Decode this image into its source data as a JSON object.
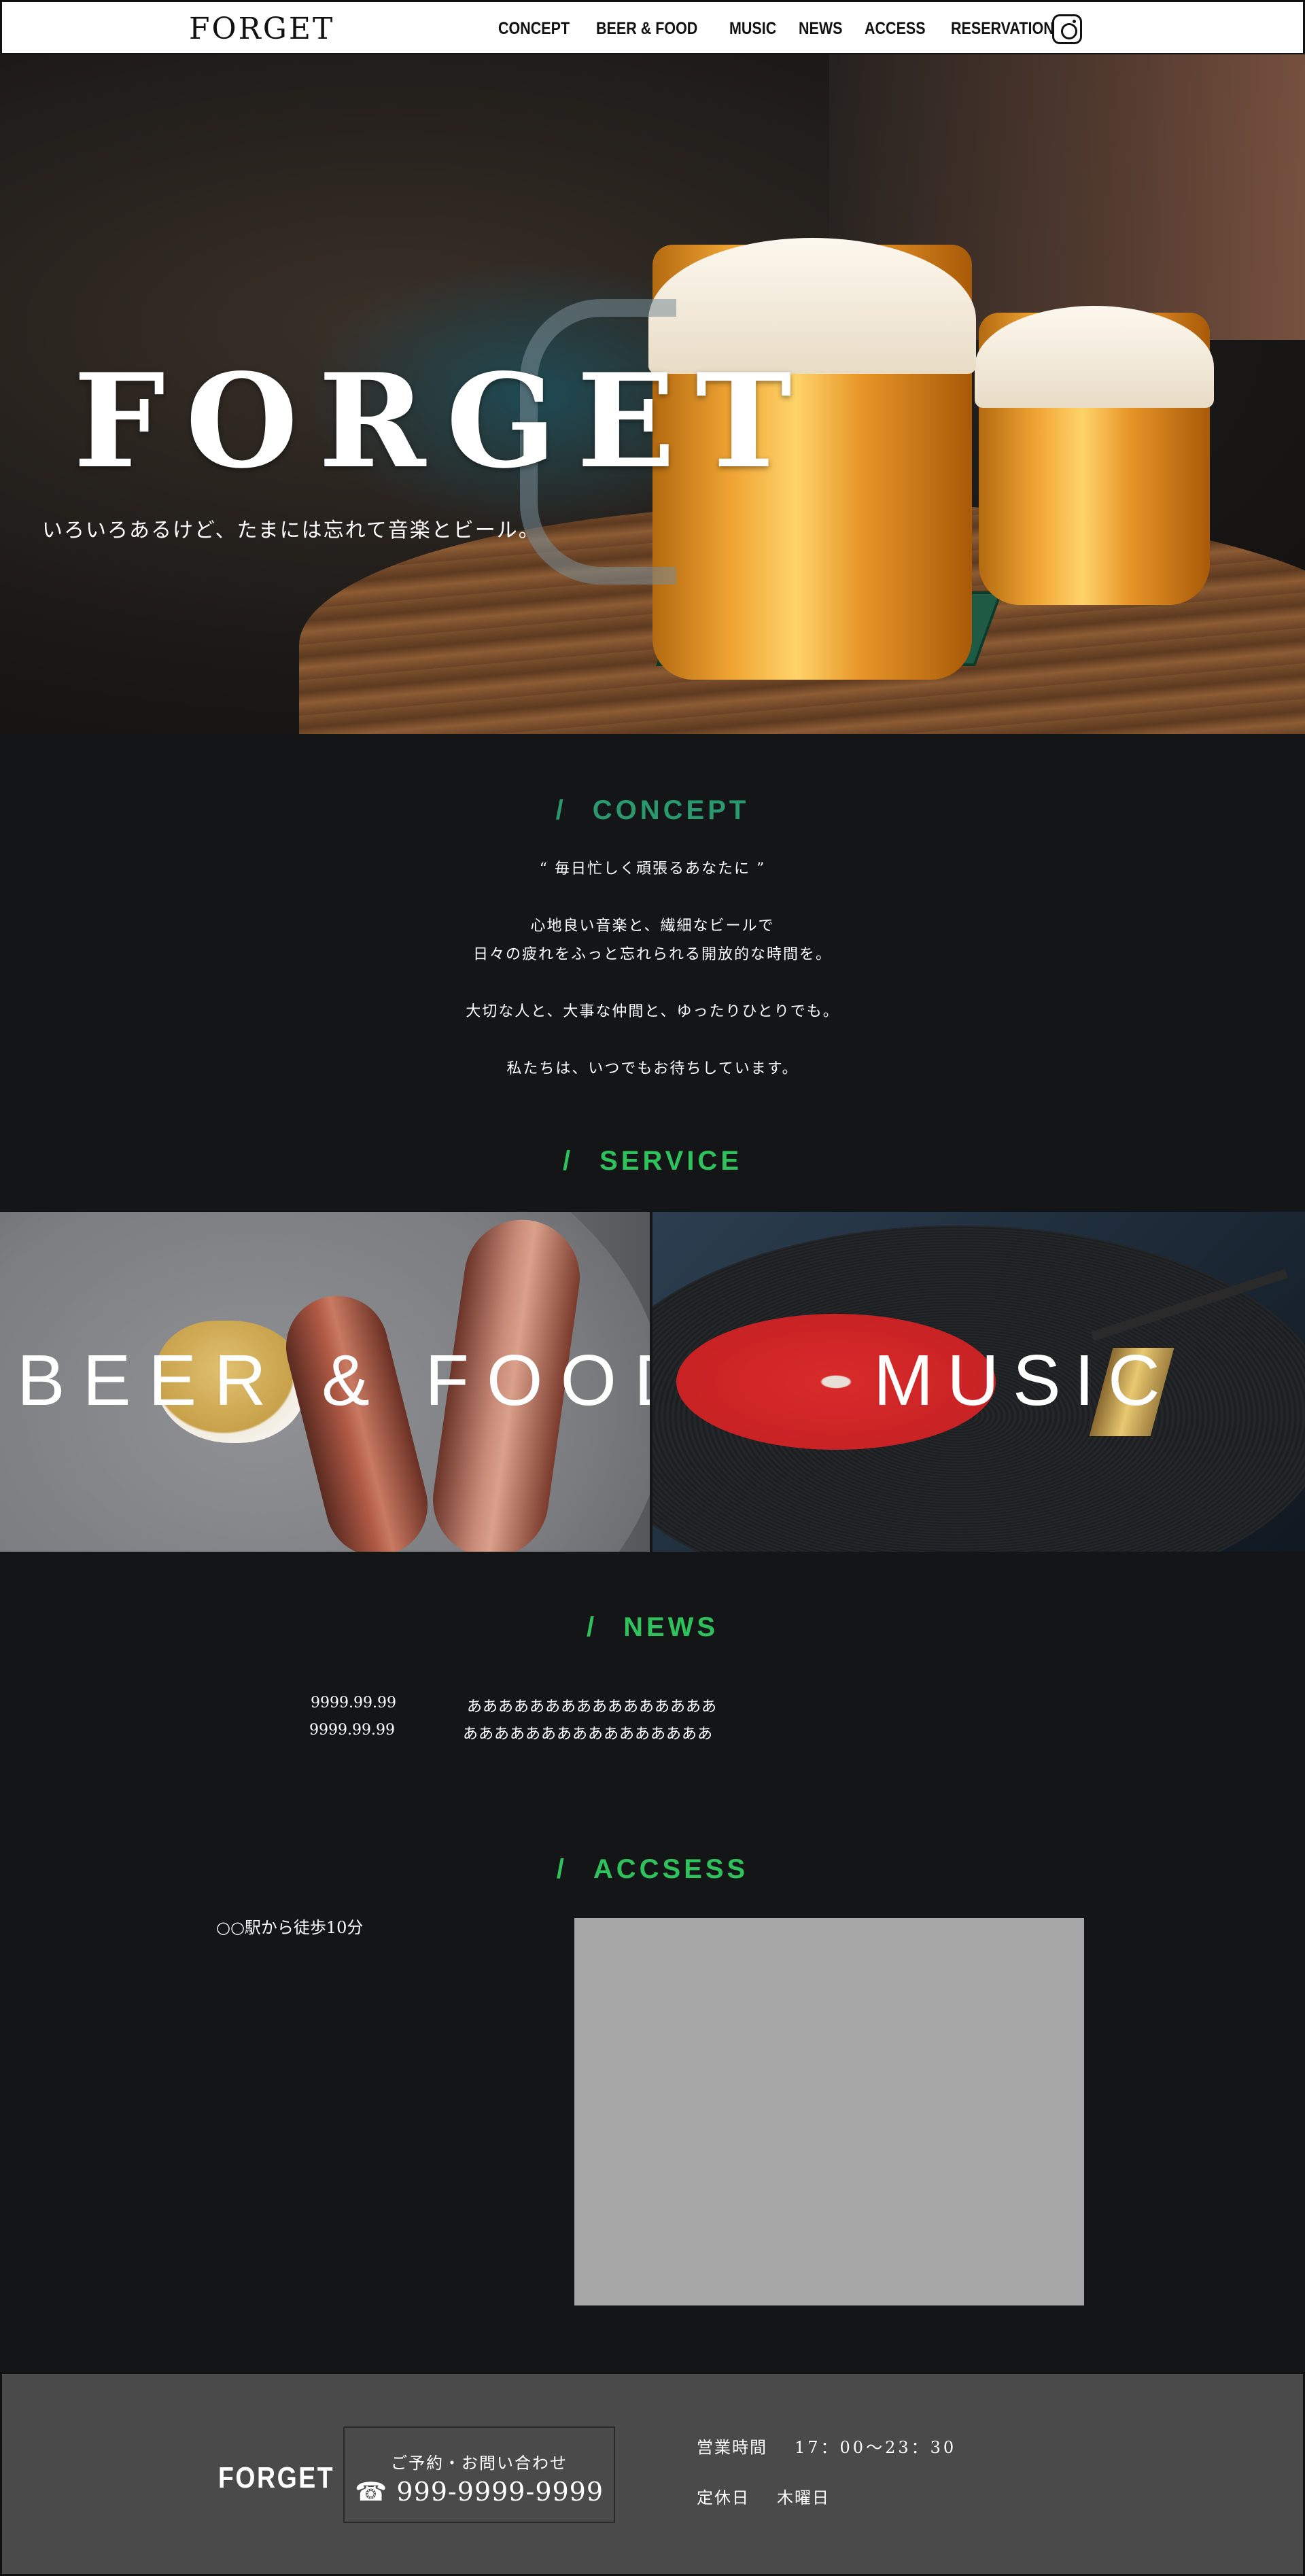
{
  "header": {
    "logo": "FORGET",
    "nav": [
      "CONCEPT",
      "BEER & FOOD",
      "MUSIC",
      "NEWS",
      "ACCESS",
      "RESERVATION"
    ],
    "instagram_icon": "instagram-icon"
  },
  "hero": {
    "title": "FORGET",
    "subtitle": "いろいろあるけど、たまには忘れて音楽とビール。"
  },
  "concept": {
    "heading": "CONCEPT",
    "lines": [
      "“ 毎日忙しく頑張るあなたに ”",
      "心地良い音楽と、繊細なビールで",
      "日々の疲れをふっと忘れられる開放的な時間を。",
      "大切な人と、大事な仲間と、ゆったりひとりでも。",
      "私たちは、いつでもお待ちしています。"
    ]
  },
  "service": {
    "heading": "SERVICE",
    "items": [
      {
        "label": "BEER & FOOD"
      },
      {
        "label": "MUSIC"
      }
    ]
  },
  "news": {
    "heading": "NEWS",
    "items": [
      {
        "date": "9999.99.99",
        "title": "ああああああああああああああああ"
      },
      {
        "date": "9999.99.99",
        "title": "ああああああああああああああああ"
      }
    ]
  },
  "access": {
    "heading": "ACCSESS",
    "directions": "○○駅から徒歩10分"
  },
  "footer": {
    "logo": "FORGET",
    "contact_label": "ご予約・お問い合わせ",
    "tel_icon": "☎",
    "tel": "999-9999-9999",
    "hours_label": "営業時間",
    "hours_value": "17：00〜23：30",
    "closed_label": "定休日",
    "closed_value": "木曜日"
  },
  "colors": {
    "concept_heading": "#2a9a6e",
    "section_heading": "#2fc25c",
    "background": "#141517",
    "footer": "#4a4a4a",
    "map_placeholder": "#a6a6a6"
  }
}
